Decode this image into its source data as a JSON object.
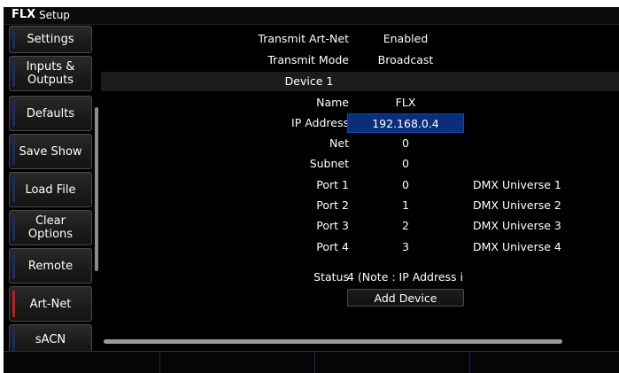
{
  "app": {
    "logo": "FLX",
    "title": "Setup"
  },
  "sidebar": {
    "items": [
      {
        "label": "Settings",
        "active": false
      },
      {
        "label": "Inputs &\nOutputs",
        "active": false
      },
      {
        "label": "Defaults",
        "active": false
      },
      {
        "label": "Save Show",
        "active": false
      },
      {
        "label": "Load File",
        "active": false
      },
      {
        "label": "Clear\nOptions",
        "active": false
      },
      {
        "label": "Remote",
        "active": false
      },
      {
        "label": "Art-Net",
        "active": true
      },
      {
        "label": "sACN",
        "active": false
      }
    ]
  },
  "settings": {
    "transmit_artnet": {
      "label": "Transmit Art-Net",
      "value": "Enabled"
    },
    "transmit_mode": {
      "label": "Transmit Mode",
      "value": "Broadcast"
    }
  },
  "device": {
    "header": "Device 1",
    "name": {
      "label": "Name",
      "value": "FLX"
    },
    "ip": {
      "label": "IP Address",
      "value": "192.168.0.4"
    },
    "net": {
      "label": "Net",
      "value": "0"
    },
    "subnet": {
      "label": "Subnet",
      "value": "0"
    },
    "ports": [
      {
        "label": "Port 1",
        "value": "0",
        "universe": "DMX Universe 1"
      },
      {
        "label": "Port 2",
        "value": "1",
        "universe": "DMX Universe 2"
      },
      {
        "label": "Port 3",
        "value": "2",
        "universe": "DMX Universe 3"
      },
      {
        "label": "Port 4",
        "value": "3",
        "universe": "DMX Universe 4"
      }
    ],
    "status": {
      "label": "Status",
      "value": "4 (Note : IP Address i"
    }
  },
  "actions": {
    "add_device": "Add Device"
  },
  "colors": {
    "selection": "#0a2e7a",
    "active_indicator": "#d01818",
    "indicator": "#1a2a6a"
  }
}
